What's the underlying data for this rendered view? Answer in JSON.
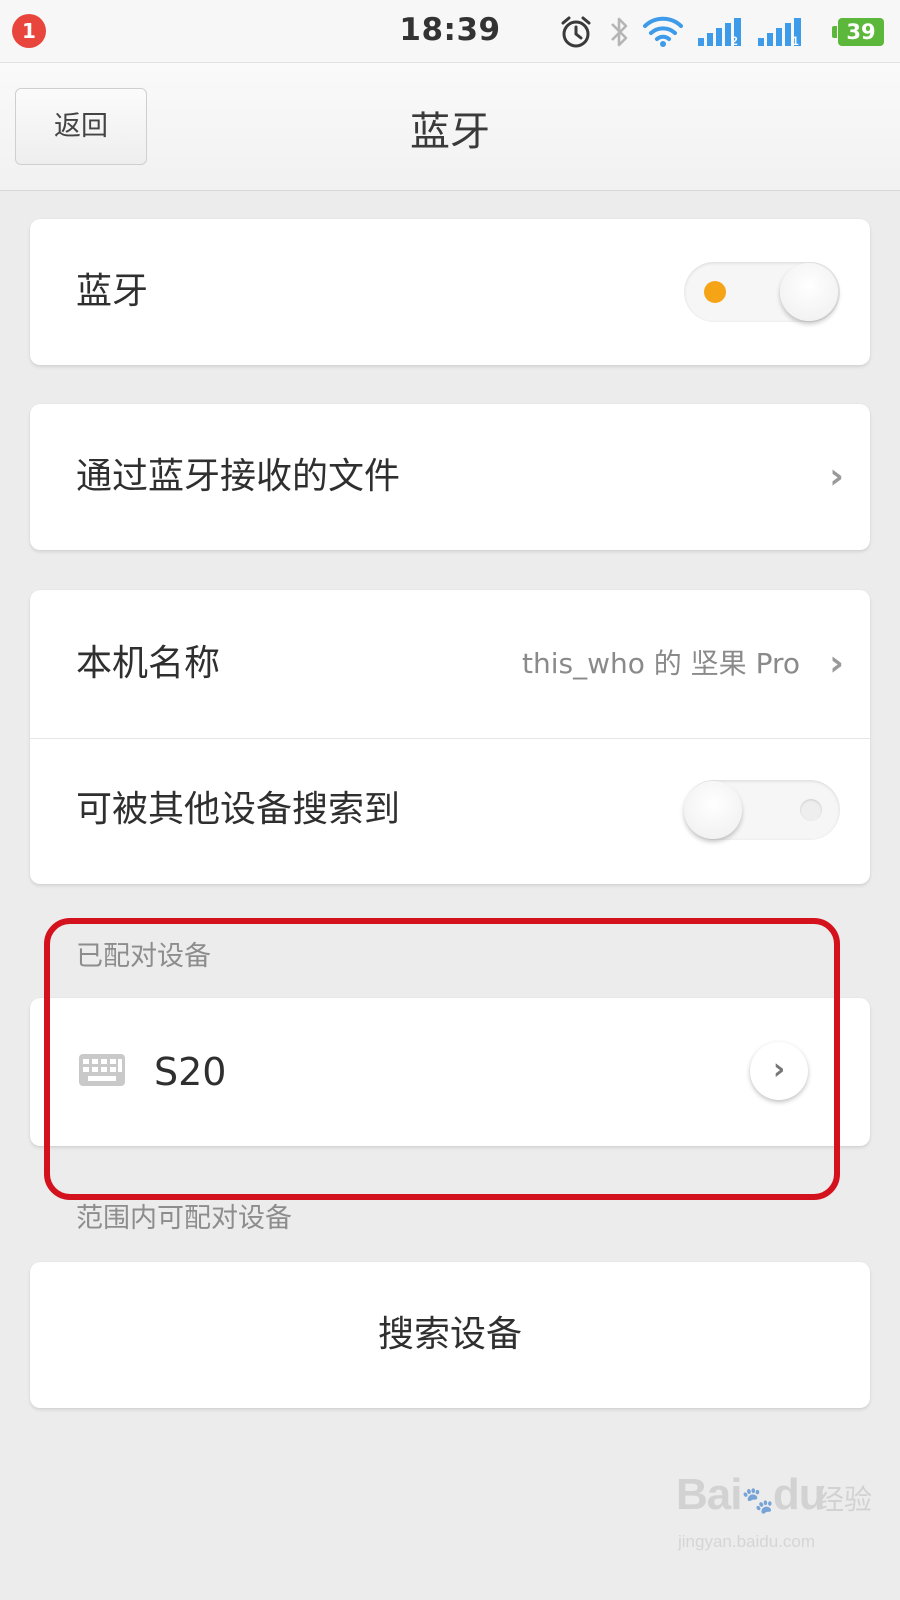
{
  "status_bar": {
    "notification_count": "1",
    "time": "18:39",
    "battery_level": "39",
    "icons": [
      "alarm-icon",
      "bluetooth-icon",
      "wifi-icon",
      "signal-sim2-icon",
      "signal-sim1-icon"
    ],
    "sim1_label": "1",
    "sim2_label": "2"
  },
  "header": {
    "back_label": "返回",
    "title": "蓝牙"
  },
  "bluetooth_toggle": {
    "label": "蓝牙",
    "enabled": true,
    "accent_color": "#f5a416"
  },
  "received_files": {
    "label": "通过蓝牙接收的文件"
  },
  "device_settings": {
    "name_label": "本机名称",
    "name_value": "this_who 的 坚果 Pro",
    "discoverable_label": "可被其他设备搜索到",
    "discoverable": false
  },
  "paired_devices": {
    "header": "已配对设备",
    "items": [
      {
        "name": "S20",
        "icon": "keyboard-icon"
      }
    ]
  },
  "available_devices": {
    "header": "范围内可配对设备",
    "search_label": "搜索设备"
  },
  "watermark": {
    "logo_text": "Bai",
    "logo_text2": "du",
    "label": "经验",
    "url": "jingyan.baidu.com"
  },
  "colors": {
    "highlight": "#d4121e",
    "battery": "#5cb83a",
    "notification": "#e8453c",
    "wifi": "#3d9be9",
    "signal": "#3d9be9"
  }
}
